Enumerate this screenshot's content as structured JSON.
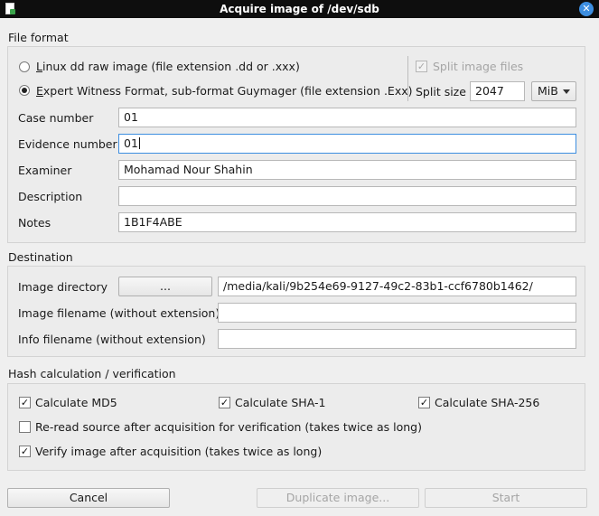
{
  "window": {
    "title": "Acquire image of /dev/sdb"
  },
  "file_format": {
    "section_label": "File format",
    "option_dd": {
      "prefix": "L",
      "label": "inux dd raw image (file extension .dd or .xxx)"
    },
    "option_ewf": {
      "prefix": "E",
      "label": "xpert Witness Format, sub-format Guymager (file extension .Exx)"
    },
    "split_image_label": "Split image files",
    "split_size_label": "Split size",
    "split_size_value": "2047",
    "split_unit": "MiB"
  },
  "case": {
    "case_number_label": "Case number",
    "case_number_value": "01",
    "evidence_number_label": "Evidence number",
    "evidence_number_value": "01",
    "examiner_label": "Examiner",
    "examiner_value": "Mohamad Nour Shahin",
    "description_label": "Description",
    "description_value": "",
    "notes_label": "Notes",
    "notes_value": "1B1F4ABE"
  },
  "destination": {
    "section_label": "Destination",
    "image_directory_label": "Image directory",
    "browse_label": "...",
    "image_directory_value": "/media/kali/9b254e69-9127-49c2-83b1-ccf6780b1462/",
    "image_filename_label": "Image filename (without extension)",
    "image_filename_value": "",
    "info_filename_label": "Info filename (without extension)",
    "info_filename_value": ""
  },
  "hash": {
    "section_label": "Hash calculation / verification",
    "md5_label": "Calculate MD5",
    "sha1_label": "Calculate SHA-1",
    "sha256_label": "Calculate SHA-256",
    "reread_label": "Re-read source after acquisition for verification (takes twice as long)",
    "verify_label": "Verify image after acquisition (takes twice as long)"
  },
  "buttons": {
    "cancel": "Cancel",
    "duplicate": "Duplicate image...",
    "start": "Start"
  },
  "icons": {
    "check": "✓",
    "close": "✕"
  }
}
